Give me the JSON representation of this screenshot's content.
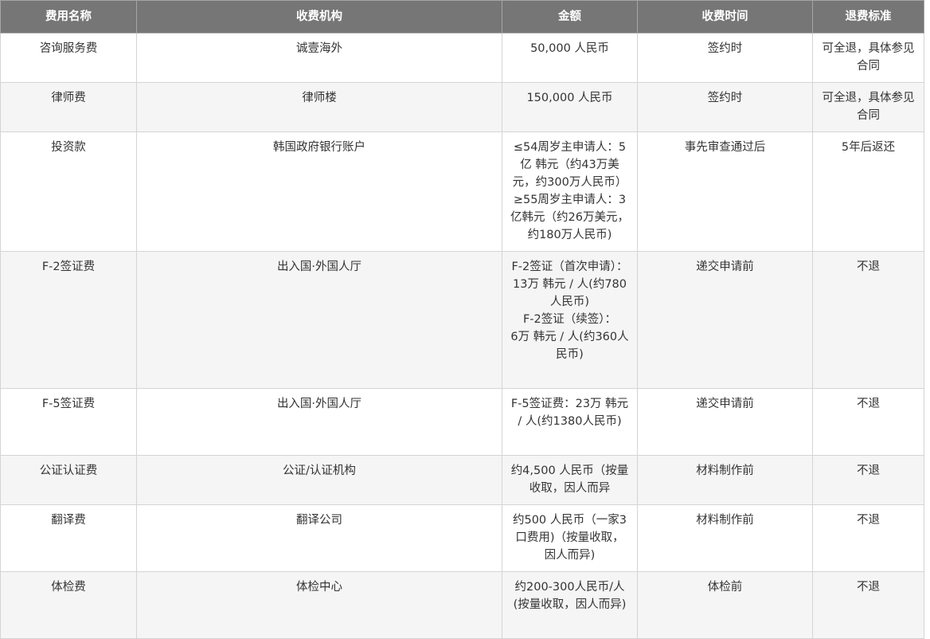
{
  "table": {
    "headers": [
      "费用名称",
      "收费机构",
      "金额",
      "收费时间",
      "退费标准"
    ],
    "rows": [
      [
        "咨询服务费",
        "诚壹海外",
        "50,000 人民币",
        "签约时",
        "可全退，具体参见合同"
      ],
      [
        "律师费",
        "律师楼",
        "150,000 人民币",
        "签约时",
        "可全退，具体参见合同"
      ],
      [
        "投资款",
        "韩国政府银行账户",
        "≤54周岁主申请人：5亿 韩元（约43万美元，约300万人民币）≥55周岁主申请人：3亿韩元（约26万美元，约180万人民币)",
        "事先审查通过后",
        "5年后返还"
      ],
      [
        "F-2签证费",
        "出入国·外国人厅",
        "F-2签证（首次申请）：\n13万 韩元 / 人(约780人民币)\nF-2签证（续签）：\n6万 韩元 / 人(约360人民币)",
        "递交申请前",
        "不退"
      ],
      [
        "F-5签证费",
        "出入国·外国人厅",
        "F-5签证费：23万 韩元 / 人(约1380人民币)",
        "递交申请前",
        "不退"
      ],
      [
        "公证认证费",
        "公证/认证机构",
        "约4,500 人民币（按量收取，因人而异",
        "材料制作前",
        "不退"
      ],
      [
        "翻译费",
        "翻译公司",
        "约500 人民币（一家3口费用)（按量收取，因人而异)",
        "材料制作前",
        "不退"
      ],
      [
        "体检费",
        "体检中心",
        "约200-300人民币/人(按量收取，因人而异)",
        "体检前",
        "不退"
      ]
    ]
  }
}
